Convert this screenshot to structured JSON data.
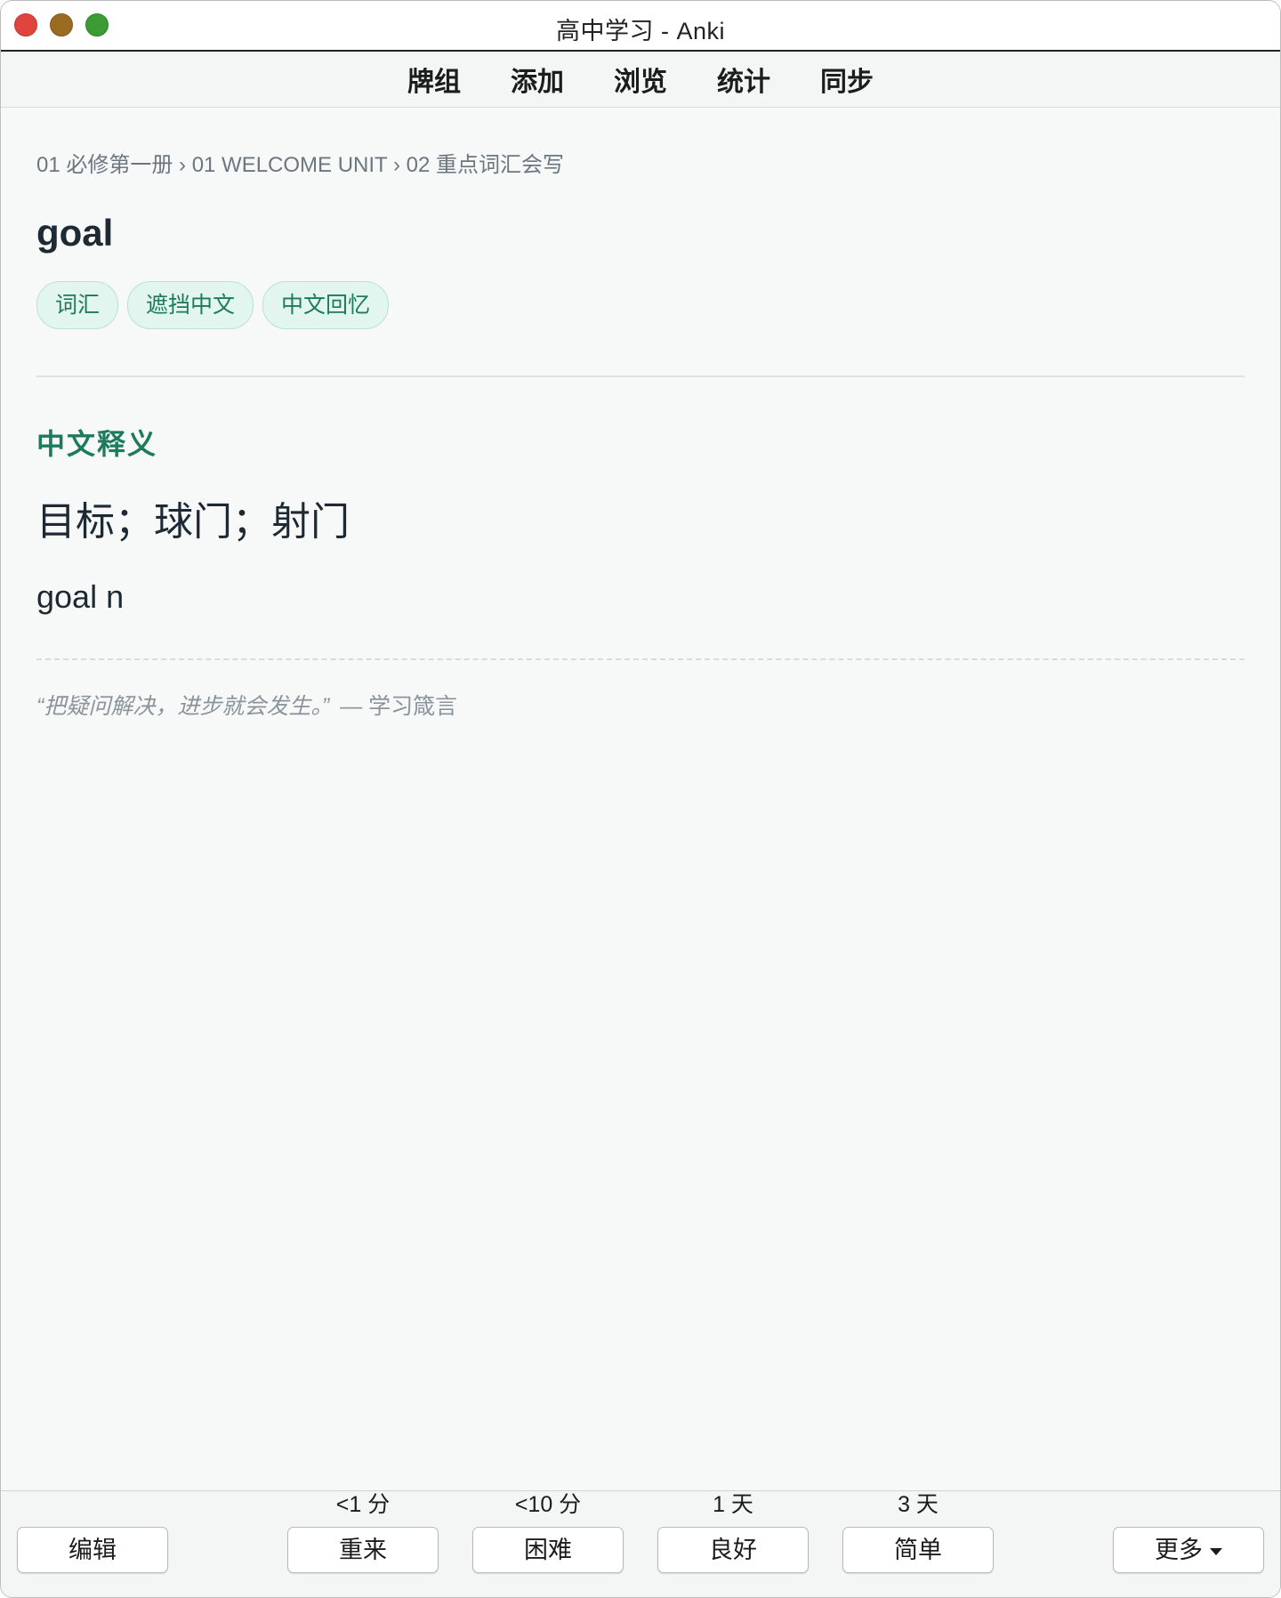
{
  "window": {
    "title": "高中学习 - Anki"
  },
  "topmenu": {
    "items": [
      {
        "label": "牌组"
      },
      {
        "label": "添加"
      },
      {
        "label": "浏览"
      },
      {
        "label": "统计"
      },
      {
        "label": "同步"
      }
    ]
  },
  "card": {
    "breadcrumb": "01 必修第一册 › 01 WELCOME UNIT › 02 重点词汇会写",
    "word": "goal",
    "tags": [
      "词汇",
      "遮挡中文",
      "中文回忆"
    ],
    "section_heading": "中文释义",
    "meaning": "目标；球门；射门",
    "pos_line": "goal n",
    "quote_text": "“把疑问解决，进步就会发生。”",
    "quote_source": "— 学习箴言"
  },
  "bottombar": {
    "edit_label": "编辑",
    "more_label": "更多",
    "answers": [
      {
        "label": "重来",
        "interval": "<1 分"
      },
      {
        "label": "困难",
        "interval": "<10 分"
      },
      {
        "label": "良好",
        "interval": "1 天"
      },
      {
        "label": "简单",
        "interval": "3 天"
      }
    ]
  },
  "icons": {
    "more_dropdown": "caret-down-icon"
  }
}
